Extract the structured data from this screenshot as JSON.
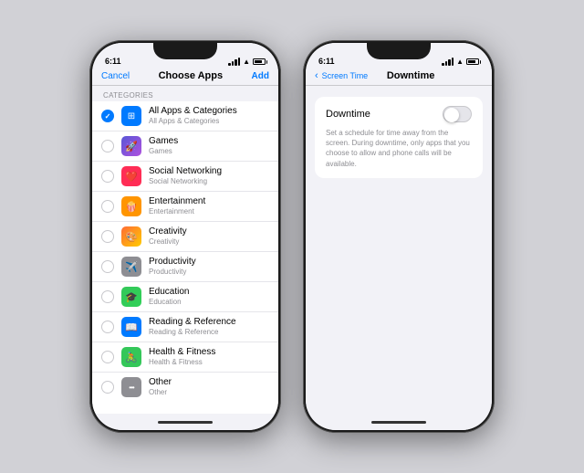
{
  "phone1": {
    "status": {
      "time": "6:11",
      "signal": true,
      "wifi": true,
      "battery": true
    },
    "nav": {
      "cancel": "Cancel",
      "title": "Choose Apps",
      "add": "Add"
    },
    "section_label": "CATEGORIES",
    "categories": [
      {
        "id": "all",
        "label": "All Apps & Categories",
        "subtitle": "All Apps & Categories",
        "icon": "🔵",
        "icon_bg": "#007aff",
        "checked": true,
        "icon_char": "✓"
      },
      {
        "id": "games",
        "label": "Games",
        "subtitle": "Games",
        "icon": "🚀",
        "icon_bg": "#5856d6",
        "checked": false
      },
      {
        "id": "social",
        "label": "Social Networking",
        "subtitle": "Social Networking",
        "icon": "❤️",
        "icon_bg": "#ff3b30",
        "checked": false
      },
      {
        "id": "entertainment",
        "label": "Entertainment",
        "subtitle": "Entertainment",
        "icon": "🍿",
        "icon_bg": "#ff9500",
        "checked": false
      },
      {
        "id": "creativity",
        "label": "Creativity",
        "subtitle": "Creativity",
        "icon": "🎨",
        "icon_bg": "#ff6b35",
        "checked": false
      },
      {
        "id": "productivity",
        "label": "Productivity",
        "subtitle": "Productivity",
        "icon": "✈️",
        "icon_bg": "#8e8e93",
        "checked": false
      },
      {
        "id": "education",
        "label": "Education",
        "subtitle": "Education",
        "icon": "🎓",
        "icon_bg": "#34c759",
        "checked": false
      },
      {
        "id": "reading",
        "label": "Reading & Reference",
        "subtitle": "Reading & Reference",
        "icon": "📖",
        "icon_bg": "#007aff",
        "checked": false
      },
      {
        "id": "health",
        "label": "Health & Fitness",
        "subtitle": "Health & Fitness",
        "icon": "🚴",
        "icon_bg": "#34c759",
        "checked": false
      },
      {
        "id": "other",
        "label": "Other",
        "subtitle": "Other",
        "icon": "···",
        "icon_bg": "#8e8e93",
        "checked": false
      }
    ]
  },
  "phone2": {
    "status": {
      "time": "6:11",
      "signal": true,
      "wifi": true,
      "battery": true
    },
    "nav": {
      "back_icon": "‹",
      "back_label": "Screen Time",
      "title": "Downtime"
    },
    "downtime": {
      "label": "Downtime",
      "description": "Set a schedule for time away from the screen. During downtime, only apps that you choose to allow and phone calls will be available.",
      "toggle_on": false
    }
  }
}
